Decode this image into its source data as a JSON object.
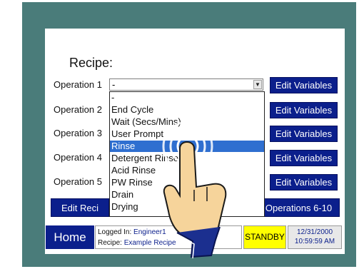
{
  "recipe_title": "Recipe:",
  "operations": [
    {
      "label": "Operation 1",
      "value": "-"
    },
    {
      "label": "Operation 2"
    },
    {
      "label": "Operation 3"
    },
    {
      "label": "Operation 4"
    },
    {
      "label": "Operation 5"
    }
  ],
  "edit_variables_label": "Edit Variables",
  "dropdown_options": [
    "-",
    "End Cycle",
    "Wait (Secs/Mins)",
    "User Prompt",
    "Rinse",
    "Detergent Rinse",
    "Acid Rinse",
    "PW Rinse",
    "Drain",
    "Drying"
  ],
  "dropdown_selected": "Rinse",
  "bottom": {
    "edit_recipe_label": "Edit Reci",
    "operations_next_label": "Operations 6-10"
  },
  "status": {
    "home_label": "Home",
    "logged_in_label": "Logged In:",
    "logged_in_value": "Engineer1",
    "recipe_label": "Recipe:",
    "recipe_value": "Example Recipe",
    "state": "STANDBY",
    "date": "12/31/2000",
    "time": "10:59:59 AM"
  },
  "colors": {
    "bezel": "#4a7c7a",
    "button": "#0b1f8c",
    "selection": "#2f6fd0",
    "standby": "#ffff00"
  },
  "icons": {
    "hand": "touch-hand-icon",
    "ripple": "touch-ripple-icon",
    "arrow": "chevron-down-icon"
  }
}
